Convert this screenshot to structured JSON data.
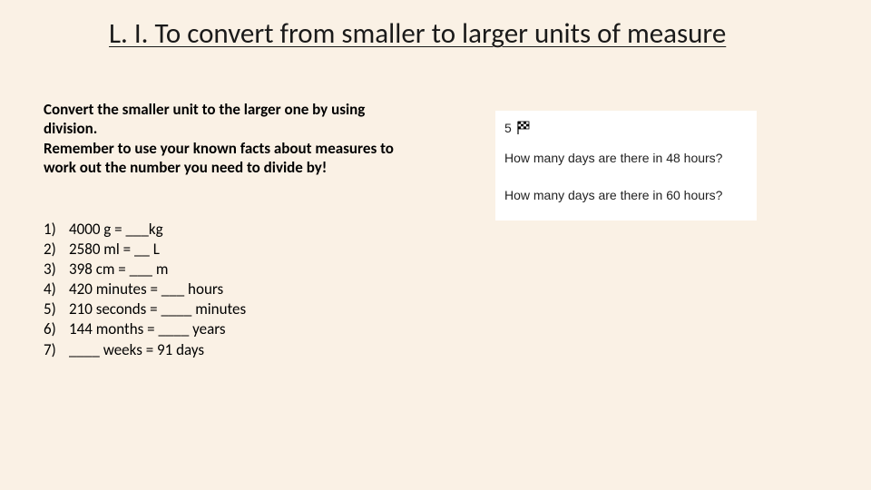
{
  "title": "L. I. To convert from smaller to larger units of measure",
  "instructions": {
    "line1": "Convert the smaller unit to the larger one by using division.",
    "line2": "Remember to use your known facts about measures to work out the number you need to divide by!"
  },
  "questions": [
    {
      "num": "1)",
      "text": "4000 g = ___kg"
    },
    {
      "num": "2)",
      "text": "2580 ml = __ L"
    },
    {
      "num": "3)",
      "text": "398 cm = ___ m"
    },
    {
      "num": "4)",
      "text": "420 minutes = ___ hours"
    },
    {
      "num": "5)",
      "text": "210 seconds = ____ minutes"
    },
    {
      "num": "6)",
      "text": "144 months = ____ years"
    },
    {
      "num": "7)",
      "text": "____ weeks = 91 days"
    }
  ],
  "side_panel": {
    "number": "5",
    "q1": "How many days are there in 48 hours?",
    "q2": "How many days are there in 60 hours?"
  }
}
